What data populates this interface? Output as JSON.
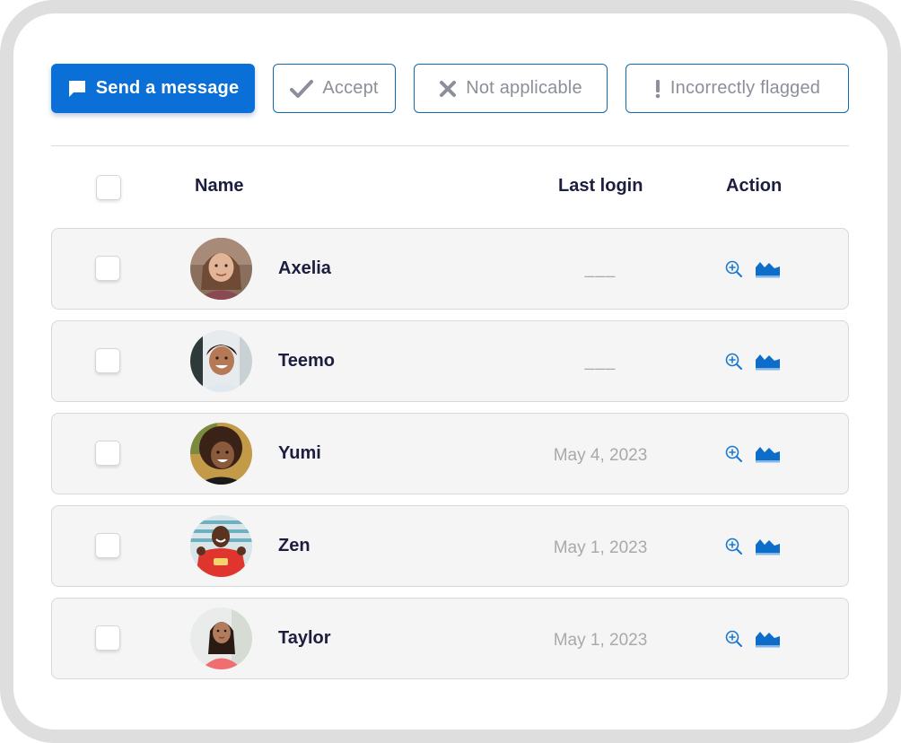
{
  "toolbar": {
    "send_label": "Send a message",
    "accept_label": "Accept",
    "not_applicable_label": "Not applicable",
    "flag_label": "Incorrectly flagged",
    "send_icon": "message-icon",
    "accept_icon": "check-icon",
    "not_applicable_icon": "x-icon",
    "flag_icon": "exclamation-icon"
  },
  "table": {
    "headers": {
      "name": "Name",
      "last_login": "Last login",
      "action": "Action"
    },
    "rows": [
      {
        "name": "Axelia",
        "last_login": "___",
        "avatar": "avatar-axelia",
        "checked": false
      },
      {
        "name": "Teemo",
        "last_login": "___",
        "avatar": "avatar-teemo",
        "checked": false
      },
      {
        "name": "Yumi",
        "last_login": "May 4, 2023",
        "avatar": "avatar-yumi",
        "checked": false
      },
      {
        "name": "Zen",
        "last_login": "May 1, 2023",
        "avatar": "avatar-zen",
        "checked": false
      },
      {
        "name": "Taylor",
        "last_login": "May 1, 2023",
        "avatar": "avatar-taylor",
        "checked": false
      }
    ],
    "actions": [
      "zoom-in-icon",
      "area-chart-icon"
    ]
  },
  "colors": {
    "primary": "#0a6fd6",
    "outline_border": "#0f6bb0",
    "text_dark": "#1d1d3f",
    "text_muted": "#8b8f99",
    "row_bg": "#f5f5f5"
  }
}
